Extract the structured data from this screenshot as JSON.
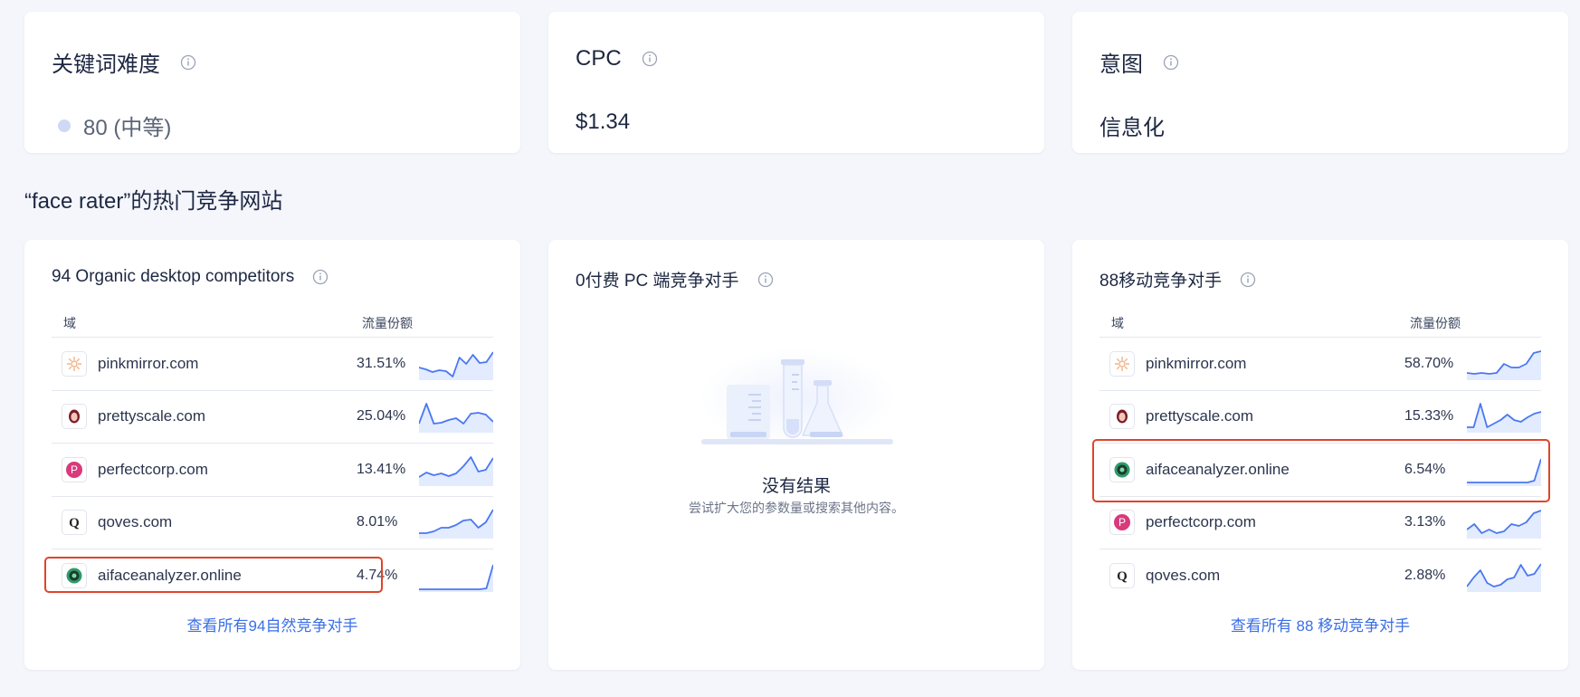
{
  "metrics": {
    "kd": {
      "title": "关键词难度",
      "value": "80 (中等)"
    },
    "cpc": {
      "title": "CPC",
      "value": "$1.34"
    },
    "intent": {
      "title": "意图",
      "value": "信息化"
    }
  },
  "section_heading": "“face rater”的热门竞争网站",
  "organic": {
    "title": "94 Organic desktop competitors",
    "col_domain": "域",
    "col_share": "流量份额",
    "rows": [
      {
        "domain": "pinkmirror.com",
        "share": "31.51%",
        "icon": "pinkmirror-favicon"
      },
      {
        "domain": "prettyscale.com",
        "share": "25.04%",
        "icon": "prettyscale-favicon"
      },
      {
        "domain": "perfectcorp.com",
        "share": "13.41%",
        "icon": "perfectcorp-favicon"
      },
      {
        "domain": "qoves.com",
        "share": "8.01%",
        "icon": "qoves-favicon"
      },
      {
        "domain": "aifaceanalyzer.online",
        "share": "4.74%",
        "icon": "aifaceanalyzer-favicon"
      }
    ],
    "view_all": "查看所有94自然竞争对手"
  },
  "paid": {
    "title": "0付费 PC 端竞争对手",
    "empty_title": "没有结果",
    "empty_sub": "尝试扩大您的参数量或搜索其他内容。"
  },
  "mobile": {
    "title": "88移动竞争对手",
    "col_domain": "域",
    "col_share": "流量份额",
    "rows": [
      {
        "domain": "pinkmirror.com",
        "share": "58.70%",
        "icon": "pinkmirror-favicon"
      },
      {
        "domain": "prettyscale.com",
        "share": "15.33%",
        "icon": "prettyscale-favicon"
      },
      {
        "domain": "aifaceanalyzer.online",
        "share": "6.54%",
        "icon": "aifaceanalyzer-favicon"
      },
      {
        "domain": "perfectcorp.com",
        "share": "3.13%",
        "icon": "perfectcorp-favicon"
      },
      {
        "domain": "qoves.com",
        "share": "2.88%",
        "icon": "qoves-favicon"
      }
    ],
    "view_all": "查看所有 88 移动竞争对手"
  },
  "colors": {
    "accent": "#3a6ee8",
    "spark_line": "#4a78f0",
    "spark_fill": "#e3ebff",
    "highlight": "#e0442b"
  }
}
